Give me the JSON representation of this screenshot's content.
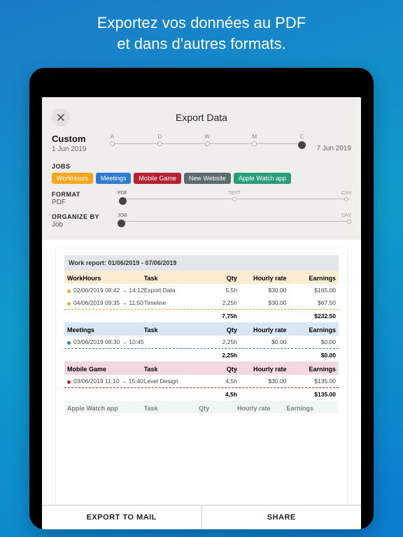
{
  "promo": {
    "line1": "Exportez vos données au PDF",
    "line2": "et dans d'autres formats."
  },
  "modal": {
    "title": "Export Data",
    "range_label": "Custom",
    "range_start": "1 Jun 2019",
    "range_end": "7 Jun 2019",
    "period_marks": [
      "A",
      "D",
      "W",
      "M",
      "C"
    ],
    "jobs_label": "JOBS",
    "jobs": [
      {
        "name": "WorkHours",
        "color": "#f5a623"
      },
      {
        "name": "Meetings",
        "color": "#2e7bd0"
      },
      {
        "name": "Mobile Game",
        "color": "#b52232"
      },
      {
        "name": "New Website",
        "color": "#5b6a6f"
      },
      {
        "name": "Apple Watch app",
        "color": "#2a9d78"
      }
    ],
    "format_label": "FORMAT",
    "format_value": "PDF",
    "format_options": [
      "PDF",
      "TEXT",
      "CSV"
    ],
    "organize_label": "ORGANIZE BY",
    "organize_value": "Job",
    "organize_options": [
      "JOB",
      "DAY"
    ]
  },
  "report": {
    "title": "Work report: 01/06/2019 - 07/06/2019",
    "columns": [
      "",
      "Task",
      "Qty",
      "Hourly rate",
      "Earnings"
    ],
    "groups": [
      {
        "name": "WorkHours",
        "hdr_bg": "#fdecd1",
        "bullet": "#f5a623",
        "rows": [
          {
            "when": "02/06/2019  08:42 → 14:12",
            "task": "Export Data",
            "qty": "5,5h",
            "rate": "$30.00",
            "earn": "$165.00"
          },
          {
            "when": "04/06/2019  09:35 → 11:50",
            "task": "Timeline",
            "qty": "2,25h",
            "rate": "$30.00",
            "earn": "$67.50"
          }
        ],
        "total": {
          "qty": "7,75h",
          "earn": "$232.50"
        }
      },
      {
        "name": "Meetings",
        "hdr_bg": "#d9e7f5",
        "bullet": "#2e7bd0",
        "rows": [
          {
            "when": "03/06/2019  08:30 → 10:45",
            "task": "",
            "qty": "2,25h",
            "rate": "$0.00",
            "earn": "$0.00"
          }
        ],
        "total": {
          "qty": "2,25h",
          "earn": "$0.00"
        }
      },
      {
        "name": "Mobile Game",
        "hdr_bg": "#f3d9dd",
        "bullet": "#b52232",
        "rows": [
          {
            "when": "03/06/2019  11:10 → 15:40",
            "task": "Level Design",
            "qty": "4,5h",
            "rate": "$30.00",
            "earn": "$135.00"
          }
        ],
        "total": {
          "qty": "4,5h",
          "earn": "$135.00"
        }
      }
    ],
    "peek": "Apple Watch app"
  },
  "actions": {
    "mail": "EXPORT TO MAIL",
    "share": "SHARE"
  }
}
